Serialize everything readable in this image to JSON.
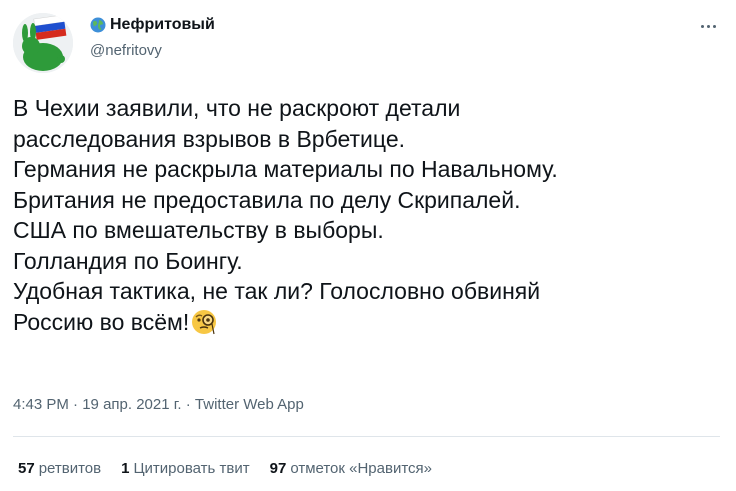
{
  "author": {
    "display_name": "Нефритовый",
    "handle": "@nefritovy",
    "name_icon": "globe-icon",
    "avatar_icon": "rabbit-flag-avatar"
  },
  "tweet": {
    "lines": [
      "В Чехии заявили, что не раскроют детали",
      "расследования взрывов в Врбетице.",
      "Германия не раскрыла материалы по Навальному.",
      "Британия не предоставила по делу Скрипалей.",
      "США по вмешательству в выборы.",
      "Голландия по Боингу.",
      "Удобная тактика, не так ли? Голословно обвиняй",
      "Россию во всём!"
    ],
    "trailing_emoji": "monocle-face-icon"
  },
  "meta": {
    "time": "4:43 PM",
    "separator": " · ",
    "date": "19 апр. 2021 г.",
    "source": "Twitter Web App"
  },
  "stats": {
    "retweets_count": "57",
    "retweets_label": "ретвитов",
    "quotes_count": "1",
    "quotes_label": "Цитировать твит",
    "likes_count": "97",
    "likes_label": "отметок «Нравится»"
  },
  "colors": {
    "text": "#0f1419",
    "secondary": "#536471",
    "divider": "#dfe5ea"
  }
}
